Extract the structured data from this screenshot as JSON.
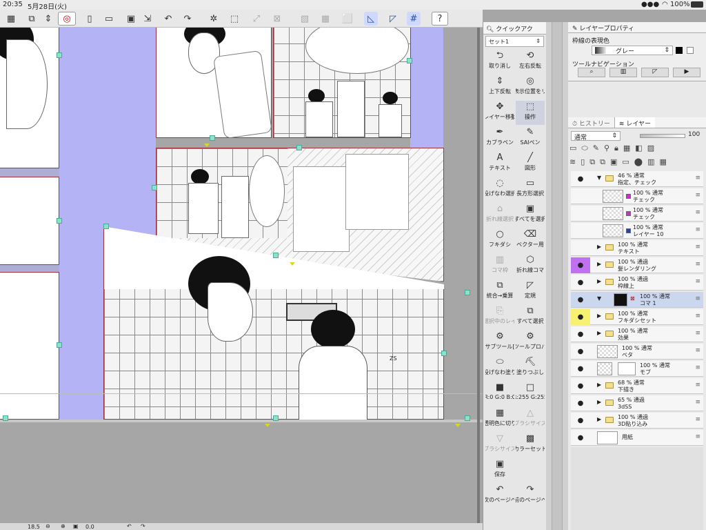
{
  "status_bar": {
    "time": "20:35",
    "date": "5月28日(火)",
    "battery": "100%"
  },
  "toolbar": {
    "icons": [
      "grid-icon",
      "window-icon",
      "stepper-icon",
      "logo-icon",
      "new-icon",
      "open-icon",
      "save-icon",
      "export-icon",
      "undo-icon",
      "redo-icon",
      "spinner-icon",
      "transform-icon",
      "warp-icon",
      "fill-icon",
      "select-icon",
      "pen-icon",
      "ruler-icon",
      "grid-snap-icon",
      "help-icon"
    ]
  },
  "quick_access": {
    "tab_label": "クイックアク",
    "set_label": "セット1",
    "items": [
      {
        "label": "取り消し",
        "icon": "⮌",
        "enabled": true
      },
      {
        "label": "左右反転",
        "icon": "⟲",
        "enabled": true
      },
      {
        "label": "上下反転",
        "icon": "⇕",
        "enabled": true
      },
      {
        "label": "表示位置をリ",
        "icon": "◎",
        "enabled": true
      },
      {
        "label": "レイヤー移動",
        "icon": "✥",
        "enabled": true
      },
      {
        "label": "操作",
        "icon": "⬚",
        "enabled": true,
        "active": true
      },
      {
        "label": "カブラペン",
        "icon": "✒",
        "enabled": true
      },
      {
        "label": "SAIペン",
        "icon": "✎",
        "enabled": true
      },
      {
        "label": "テキスト",
        "icon": "A",
        "enabled": true
      },
      {
        "label": "図形",
        "icon": "╱",
        "enabled": true
      },
      {
        "label": "投げなわ選択",
        "icon": "◌",
        "enabled": true
      },
      {
        "label": "長方形選択",
        "icon": "▭",
        "enabled": true
      },
      {
        "label": "折れ線選択",
        "icon": "⌂",
        "enabled": false
      },
      {
        "label": "すべてを選択",
        "icon": "▣",
        "enabled": true
      },
      {
        "label": "フキダシ",
        "icon": "○",
        "enabled": true
      },
      {
        "label": "ベクター用",
        "icon": "⌫",
        "enabled": true
      },
      {
        "label": "コマ枠",
        "icon": "▥",
        "enabled": false
      },
      {
        "label": "折れ線コマ",
        "icon": "⬡",
        "enabled": true
      },
      {
        "label": "統合→乗算",
        "icon": "⧉",
        "enabled": true
      },
      {
        "label": "定規",
        "icon": "◸",
        "enabled": true
      },
      {
        "label": "選択中のレイ",
        "icon": "⎘",
        "enabled": false
      },
      {
        "label": "すべて選択",
        "icon": "⧉",
        "enabled": true
      },
      {
        "label": "サブツール[",
        "icon": "⚙",
        "enabled": true
      },
      {
        "label": "ツールプロパ",
        "icon": "⚙",
        "enabled": true
      },
      {
        "label": "投げなわ塗り",
        "icon": "⬭",
        "enabled": true
      },
      {
        "label": "塗りつぶし",
        "icon": "⛏",
        "enabled": true
      },
      {
        "label": "R:0 G:0 B:0",
        "icon": "■",
        "enabled": true
      },
      {
        "label": "R:255 G:255",
        "icon": "□",
        "enabled": true
      },
      {
        "label": "透明色に切り",
        "icon": "▦",
        "enabled": true
      },
      {
        "label": "ブラシサイズ",
        "icon": "△",
        "enabled": false
      },
      {
        "label": "ブラシサイズ",
        "icon": "▽",
        "enabled": false
      },
      {
        "label": "カラーセット",
        "icon": "▩",
        "enabled": true
      },
      {
        "label": "保存",
        "icon": "▣",
        "enabled": true
      },
      {
        "label": "",
        "icon": "",
        "enabled": false
      },
      {
        "label": "次のページへ",
        "icon": "↶",
        "enabled": true
      },
      {
        "label": "前のページへ",
        "icon": "↷",
        "enabled": true
      }
    ]
  },
  "layer_property": {
    "tab_label": "レイヤープロパティ",
    "border_color_label": "枠線の表現色",
    "border_color_value": "グレー",
    "tool_nav_label": "ツールナビゲーション"
  },
  "layer_panel": {
    "tabs": [
      "ヒストリー",
      "レイヤー"
    ],
    "blend_mode": "通常",
    "opacity": "100",
    "layers": [
      {
        "l1": "46 % 通常",
        "l2": "指定、チェック",
        "kind": "folder",
        "indent": 0,
        "open": true,
        "eye": true
      },
      {
        "l1": "100 % 通常",
        "l2": "チェック",
        "kind": "raster",
        "indent": 1,
        "eye": false,
        "swatch": "#e020e0"
      },
      {
        "l1": "100 % 通常",
        "l2": "チェック",
        "kind": "raster",
        "indent": 1,
        "eye": false,
        "swatch": "#e020e0"
      },
      {
        "l1": "100 % 通常",
        "l2": "レイヤー 10",
        "kind": "raster",
        "indent": 1,
        "eye": false,
        "swatch": "#2040c0"
      },
      {
        "l1": "100 % 通常",
        "l2": "テキスト",
        "kind": "folder",
        "indent": 0,
        "eye": false
      },
      {
        "l1": "100 % 通過",
        "l2": "髪レンダリング",
        "kind": "folder",
        "indent": 0,
        "eye": true,
        "color": "#c070f0"
      },
      {
        "l1": "100 % 通過",
        "l2": "枠線上",
        "kind": "folder",
        "indent": 0,
        "eye": true
      },
      {
        "l1": "100 % 通常",
        "l2": "コマ 1",
        "kind": "frame",
        "indent": 0,
        "eye": true,
        "selected": true
      },
      {
        "l1": "100 % 通常",
        "l2": "フキダシセット",
        "kind": "folder",
        "indent": 0,
        "eye": true,
        "color": "#f8f070"
      },
      {
        "l1": "100 % 通常",
        "l2": "効果",
        "kind": "folder",
        "indent": 0,
        "eye": true
      },
      {
        "l1": "100 % 通常",
        "l2": "ベタ",
        "kind": "raster",
        "indent": 0,
        "eye": true
      },
      {
        "l1": "100 % 通常",
        "l2": "モブ",
        "kind": "masked",
        "indent": 0,
        "eye": true
      },
      {
        "l1": "68 % 通常",
        "l2": "下描き",
        "kind": "folder",
        "indent": 0,
        "eye": true
      },
      {
        "l1": "65 % 通過",
        "l2": "3dSS",
        "kind": "folder",
        "indent": 0,
        "eye": true
      },
      {
        "l1": "100 % 通過",
        "l2": "3D貼り込み",
        "kind": "folder",
        "indent": 0,
        "eye": true
      },
      {
        "l1": "",
        "l2": "用紙",
        "kind": "paper",
        "indent": 0,
        "eye": true
      }
    ]
  },
  "canvas_footer": {
    "zoom": "18.5",
    "rotation": "0.0"
  },
  "canvas_text": {
    "sfx": "ZS"
  }
}
